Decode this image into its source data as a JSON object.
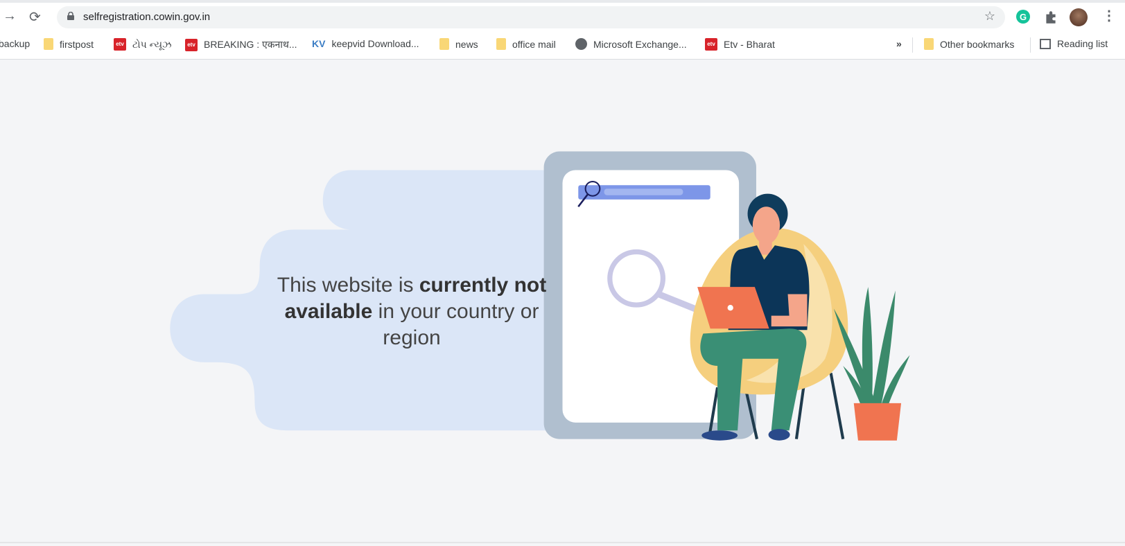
{
  "browser": {
    "url": "selfregistration.cowin.gov.in",
    "icons": {
      "back": "arrow-left-icon",
      "reload": "reload-icon",
      "lock": "lock-icon",
      "star": "star-icon",
      "grammarly": "grammarly-icon",
      "extensions": "puzzle-icon",
      "profile": "avatar",
      "menu": "kebab-menu-icon"
    },
    "bookmarks": [
      {
        "label": "backup",
        "icon": "none"
      },
      {
        "label": "firstpost",
        "icon": "folder-icon"
      },
      {
        "label": "ટોપ ન્યૂઝ",
        "icon": "etv-icon"
      },
      {
        "label": "BREAKING : एकनाथ...",
        "icon": "etv-icon"
      },
      {
        "label": "keepvid Download...",
        "icon": "kv-icon"
      },
      {
        "label": "news",
        "icon": "folder-icon"
      },
      {
        "label": "office mail",
        "icon": "folder-icon"
      },
      {
        "label": "Microsoft Exchange...",
        "icon": "globe-icon"
      },
      {
        "label": "Etv - Bharat",
        "icon": "etv-icon"
      }
    ],
    "overflow": "»",
    "other_bookmarks": "Other bookmarks",
    "reading_list": "Reading list",
    "kv": "KV",
    "etv": "etv"
  },
  "page": {
    "message_part1": "This website is ",
    "message_bold1": "currently not available",
    "message_part2": " in your country or region"
  },
  "colors": {
    "blob": "#dbe6f7",
    "frame": "#b0bfcf",
    "search_bar": "#7d96e8",
    "chair": "#f5cf7e",
    "shirt": "#0c3558",
    "laptop": "#f07450",
    "pants": "#3a8f75",
    "plant": "#3b8a6b"
  }
}
